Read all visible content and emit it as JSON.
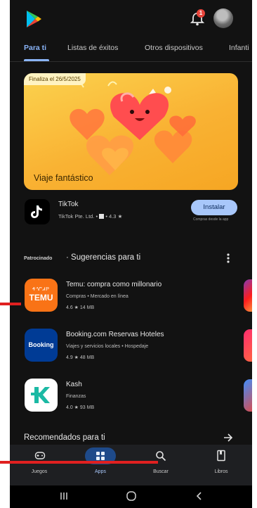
{
  "tabs": [
    "Para ti",
    "Listas de éxitos",
    "Otros dispositivos",
    "Infanti"
  ],
  "notifications": {
    "count": "1"
  },
  "promo": {
    "tag": "Finaliza el 26/5/2025",
    "title": "Viaje fantástico"
  },
  "featured_app": {
    "name": "TikTok",
    "developer": "TikTok Pte. Ltd.",
    "rating": "4.3",
    "install_label": "Instalar",
    "install_note": "Compras desde la app"
  },
  "suggestions": {
    "sponsored_label": "Patrocinado",
    "title": "Sugerencias para ti",
    "apps": [
      {
        "name": "Temu: compra como millonario",
        "category": "Compras • Mercado en línea",
        "stats": "4.6 ★   14 MB"
      },
      {
        "name": "Booking.com Reservas Hoteles",
        "category": "Viajes y servicios locales • Hospedaje",
        "stats": "4.9 ★   48 MB"
      },
      {
        "name": "Kash",
        "category": "Finanzas",
        "stats": "4.0 ★   93 MB"
      }
    ],
    "temu_icon_text": [
      "ᏎᏉᏗᏢ",
      "TEMU"
    ],
    "booking_icon_text": "Booking"
  },
  "recommended": {
    "title": "Recomendados para ti"
  },
  "bottom_nav": [
    {
      "label": "Juegos",
      "icon": "gamepad-icon"
    },
    {
      "label": "Apps",
      "icon": "apps-grid-icon",
      "selected": true
    },
    {
      "label": "Buscar",
      "icon": "search-icon"
    },
    {
      "label": "Libros",
      "icon": "book-icon"
    }
  ],
  "colors": {
    "accent": "#8ab4f8",
    "install": "#a8c7fa",
    "annotation": "#e02020"
  }
}
